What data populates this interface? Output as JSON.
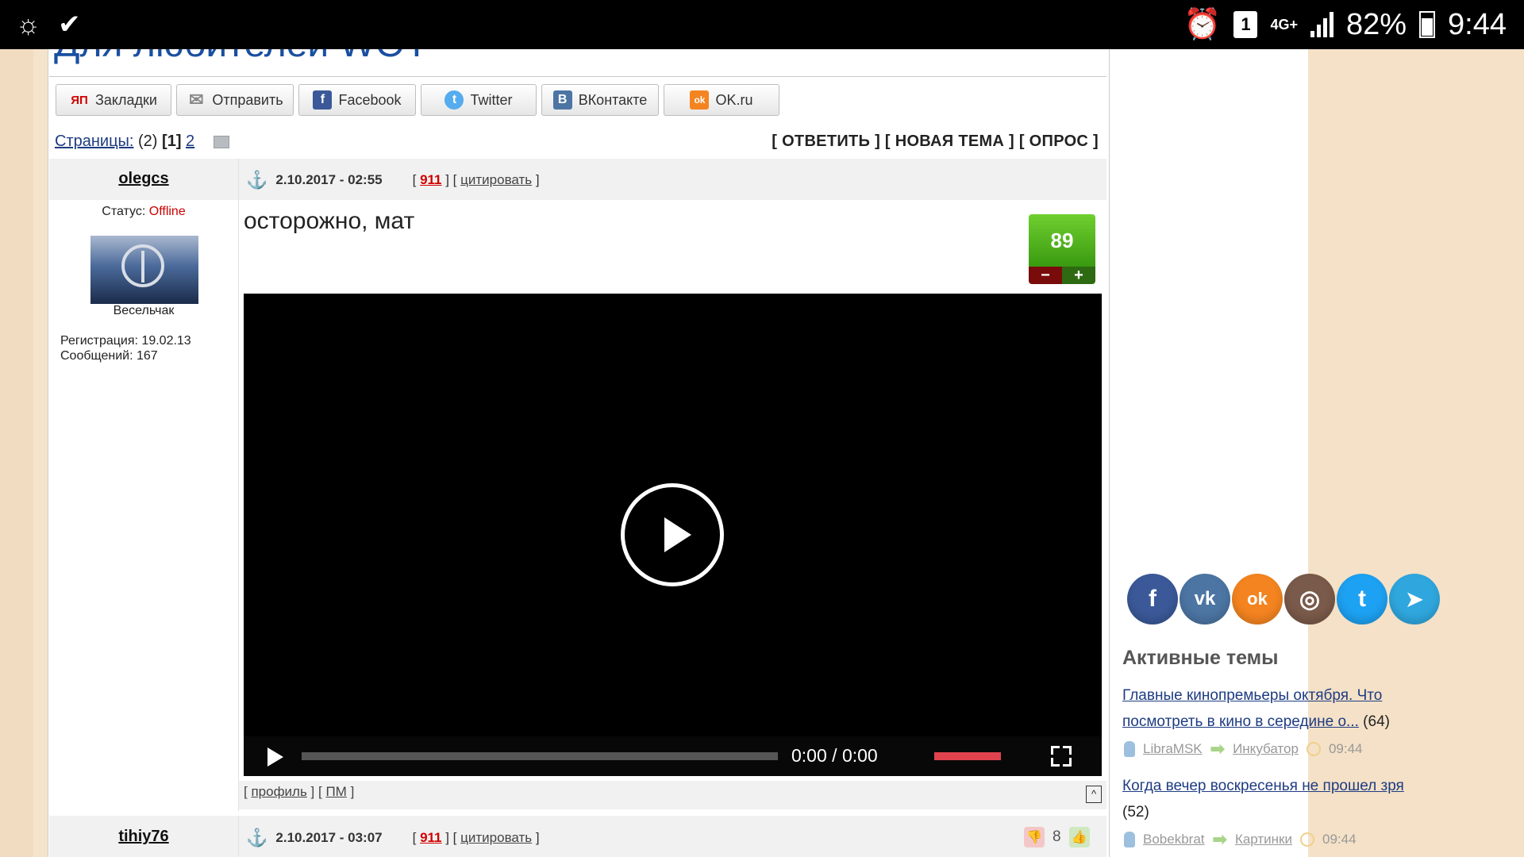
{
  "statusbar": {
    "sim_badge": "1",
    "network": "4G+",
    "battery": "82%",
    "time": "9:44"
  },
  "page": {
    "title_partial": "Для любителей WOT"
  },
  "share_buttons": [
    {
      "label": "Закладки",
      "icon_text": "ЯП",
      "color": "#d40000"
    },
    {
      "label": "Отправить",
      "icon_text": "✉",
      "color": "#888888"
    },
    {
      "label": "Facebook",
      "icon_text": "f",
      "color": "#3b5998"
    },
    {
      "label": "Twitter",
      "icon_text": "t",
      "color": "#55acee"
    },
    {
      "label": "ВКонтакте",
      "icon_text": "В",
      "color": "#4c75a3"
    },
    {
      "label": "OK.ru",
      "icon_text": "ok",
      "color": "#f48420"
    }
  ],
  "pager": {
    "label": "Страницы:",
    "count": "(2)",
    "current": "[1]",
    "next": "2",
    "actions": "[ ОТВЕТИТЬ ] [ НОВАЯ ТЕМА ] [ ОПРОС ]"
  },
  "post1": {
    "author": "olegcs",
    "status_label": "Статус:",
    "status_value": "Offline",
    "rank": "Весельчак",
    "registration": "Регистрация: 19.02.13",
    "messages": "Сообщений: 167",
    "date": "2.10.2017 - 02:55",
    "post_number": "911",
    "quote_label": "цитировать",
    "title": "осторожно, мат",
    "rating": "89",
    "rating_minus": "−",
    "rating_plus": "+",
    "video_time": "0:00",
    "video_duration": "0:00",
    "profile_link": "профиль",
    "pm_link": "ПМ"
  },
  "post2": {
    "author": "tihiy76",
    "date": "2.10.2017 - 03:07",
    "post_number": "911",
    "quote_label": "цитировать",
    "rating": "8"
  },
  "sidebar": {
    "social": [
      {
        "name": "facebook",
        "glyph": "f",
        "color": "#3b5998"
      },
      {
        "name": "vkontakte",
        "glyph": "vk",
        "color": "#4c75a3"
      },
      {
        "name": "odnoklassniki",
        "glyph": "ok",
        "color": "#f48420"
      },
      {
        "name": "instagram",
        "glyph": "◎",
        "color": "#7a5a4a"
      },
      {
        "name": "twitter",
        "glyph": "t",
        "color": "#1da1f2"
      },
      {
        "name": "telegram",
        "glyph": "➤",
        "color": "#2fa7de"
      }
    ],
    "active_topics_title": "Активные темы",
    "topics": [
      {
        "title": "Главные кинопремьеры октября. Что посмотреть в кино в середине о...",
        "count": "(64)",
        "user": "LibraMSK",
        "category": "Инкубатор",
        "time": "09:44"
      },
      {
        "title": "Когда вечер воскресенья не прошел зря",
        "count": "(52)",
        "user": "Bobekbrat",
        "category": "Картинки",
        "time": "09:44"
      }
    ]
  }
}
